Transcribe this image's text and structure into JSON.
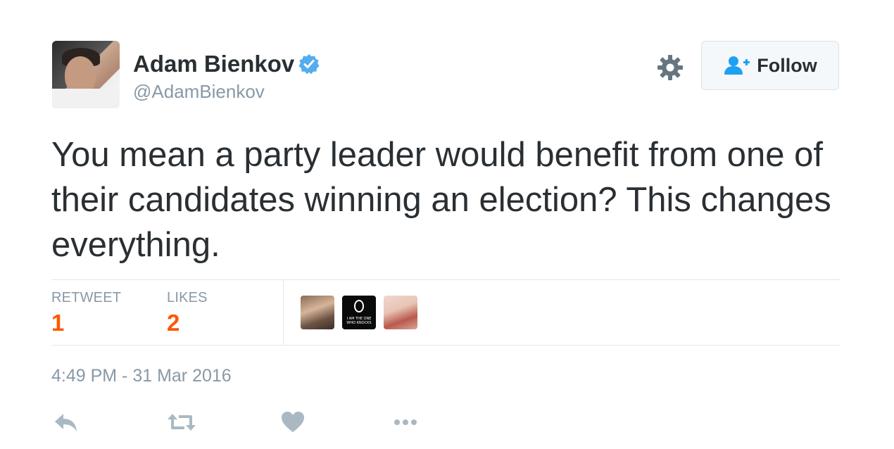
{
  "user": {
    "name": "Adam Bienkov",
    "handle": "@AdamBienkov",
    "verified": true
  },
  "header": {
    "follow_label": "Follow"
  },
  "tweet": {
    "text": "You mean a party leader would benefit from one of their candidates winning an election? This changes everything.",
    "timestamp": "4:49 PM - 31 Mar 2016"
  },
  "stats": {
    "retweets_label": "RETWEET",
    "retweets_count": "1",
    "likes_label": "LIKES",
    "likes_count": "2"
  },
  "likers": {
    "liker2_text": "I AM THE ONE WHO KNOCKS"
  },
  "colors": {
    "accent": "#1da1f2",
    "count": "#ff5500",
    "muted": "#8899a6",
    "text": "#292f33",
    "icon": "#aab8c2"
  },
  "icons": {
    "verified": "verified-badge-icon",
    "gear": "gear-icon",
    "follow": "add-user-icon",
    "reply": "reply-icon",
    "retweet": "retweet-icon",
    "like": "heart-icon",
    "more": "more-icon"
  }
}
